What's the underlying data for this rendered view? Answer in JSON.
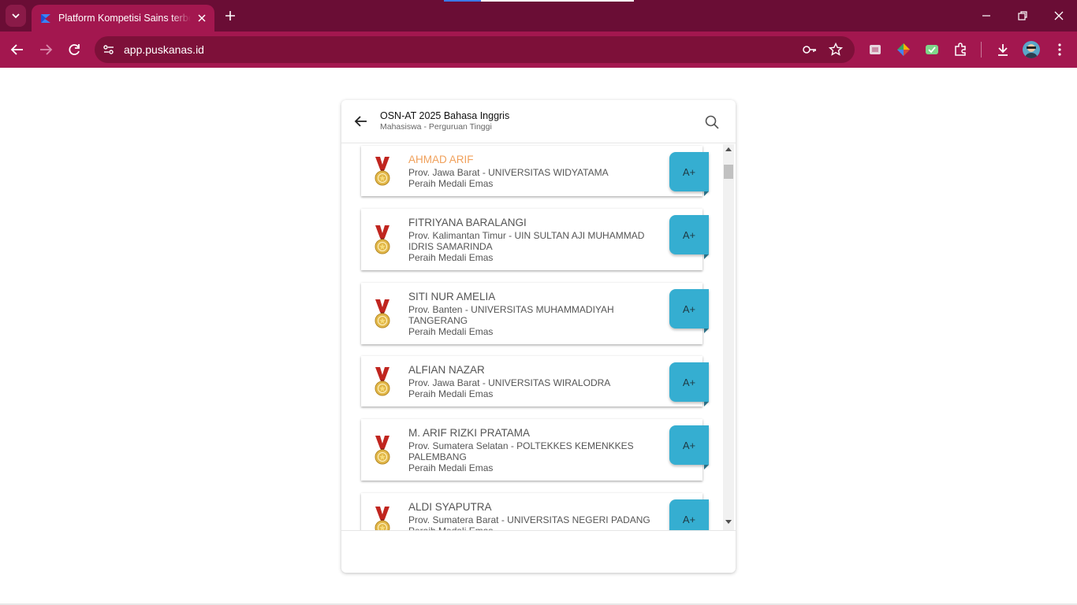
{
  "browser": {
    "tab_title": "Platform Kompetisi Sains terbesar",
    "url": "app.puskanas.id",
    "accent_color": "#a3174f",
    "frame_color": "#6a0d35"
  },
  "header": {
    "title": "OSN-AT 2025 Bahasa Inggris",
    "subtitle": "Mahasiswa - Perguruan Tinggi"
  },
  "winners": [
    {
      "name": "AHMAD ARIF",
      "region": "Prov. Jawa Barat - UNIVERSITAS WIDYATAMA",
      "award": "Peraih Medali Emas",
      "grade": "A+",
      "highlight": true
    },
    {
      "name": "FITRIYANA BARALANGI",
      "region": "Prov. Kalimantan Timur - UIN SULTAN AJI MUHAMMAD IDRIS SAMARINDA",
      "award": "Peraih Medali Emas",
      "grade": "A+",
      "highlight": false
    },
    {
      "name": "SITI NUR AMELIA",
      "region": "Prov. Banten - UNIVERSITAS MUHAMMADIYAH TANGERANG",
      "award": "Peraih Medali Emas",
      "grade": "A+",
      "highlight": false
    },
    {
      "name": "ALFIAN NAZAR",
      "region": "Prov. Jawa Barat - UNIVERSITAS WIRALODRA",
      "award": "Peraih Medali Emas",
      "grade": "A+",
      "highlight": false
    },
    {
      "name": "M. ARIF RIZKI PRATAMA",
      "region": "Prov. Sumatera Selatan - POLTEKKES KEMENKKES PALEMBANG",
      "award": "Peraih Medali Emas",
      "grade": "A+",
      "highlight": false
    },
    {
      "name": "ALDI SYAPUTRA",
      "region": "Prov. Sumatera Barat - UNIVERSITAS NEGERI PADANG",
      "award": "Peraih Medali Emas",
      "grade": "A+",
      "highlight": false
    }
  ],
  "colors": {
    "grade_badge": "#35aed1",
    "highlight_name": "#f0a05a",
    "medal_ribbon": "#c0251f",
    "medal_gold": "#e2b84a"
  },
  "icons": [
    "tab-search-icon",
    "app-favicon-icon",
    "close-icon",
    "plus-icon",
    "minimize-icon",
    "restore-icon",
    "back-arrow-icon",
    "forward-arrow-icon",
    "reload-icon",
    "site-settings-icon",
    "key-icon",
    "star-icon",
    "extension-icon",
    "puzzle-icon",
    "download-icon",
    "kebab-menu-icon",
    "search-icon",
    "gold-medal-icon"
  ]
}
